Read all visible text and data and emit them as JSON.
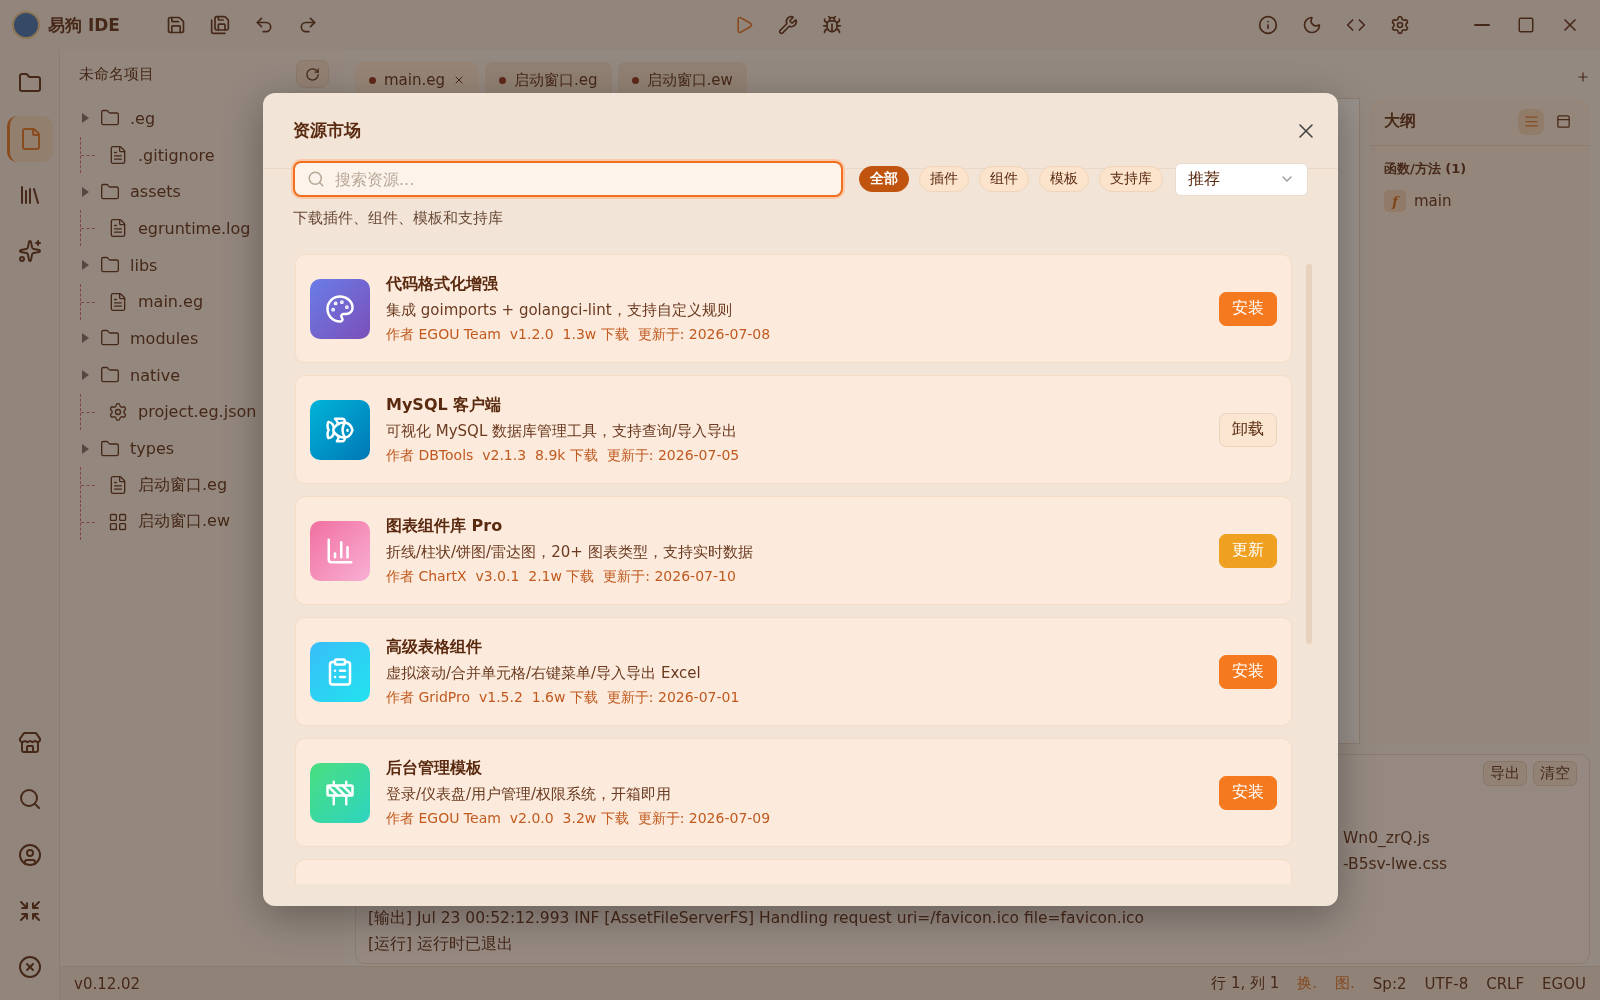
{
  "app": {
    "title": "易狗 IDE",
    "version": "v0.12.02"
  },
  "activity_bar": {
    "top": [
      {
        "kind": "folder",
        "selected": false
      },
      {
        "kind": "file",
        "selected": true
      },
      {
        "kind": "library",
        "selected": false
      },
      {
        "kind": "sparkles",
        "selected": false
      }
    ],
    "bottom": [
      {
        "kind": "store"
      },
      {
        "kind": "search"
      },
      {
        "kind": "user"
      },
      {
        "kind": "collapse"
      },
      {
        "kind": "exit"
      }
    ]
  },
  "explorer": {
    "title": "未命名项目",
    "tree": [
      {
        "name": ".eg",
        "kind": "folder",
        "expanded": false
      },
      {
        "name": ".gitignore",
        "kind": "file"
      },
      {
        "name": "assets",
        "kind": "folder",
        "expanded": false
      },
      {
        "name": "egruntime.log",
        "kind": "file"
      },
      {
        "name": "libs",
        "kind": "folder",
        "expanded": false
      },
      {
        "name": "main.eg",
        "kind": "file"
      },
      {
        "name": "modules",
        "kind": "folder",
        "expanded": false
      },
      {
        "name": "native",
        "kind": "folder",
        "expanded": false
      },
      {
        "name": "project.eg.json",
        "kind": "config"
      },
      {
        "name": "types",
        "kind": "folder",
        "expanded": false
      },
      {
        "name": "启动窗口.eg",
        "kind": "file"
      },
      {
        "name": "启动窗口.ew",
        "kind": "form"
      }
    ]
  },
  "tabs": [
    {
      "label": "main.eg",
      "selected": true
    },
    {
      "label": "启动窗口.eg",
      "selected": false
    },
    {
      "label": "启动窗口.ew",
      "selected": false
    }
  ],
  "outline": {
    "title": "大纲",
    "views": [
      {
        "kind": "list",
        "selected": true
      },
      {
        "kind": "panel",
        "selected": false
      }
    ],
    "section": "函数/方法 (1)",
    "items": [
      {
        "badge": "f",
        "name": "main"
      }
    ]
  },
  "output": {
    "buttons": [
      "导出",
      "清空"
    ],
    "lines": [
      {
        "text": "Wn0_zrQ.js",
        "kind": "tail"
      },
      {
        "text": "-B5sv-lwe.css",
        "kind": "tail"
      },
      {
        "text": "[输出] Jul 23 00:52:12.993 INF [AssetFileServerFS] Handling request uri=/favicon.ico file=favicon.ico",
        "kind": "full"
      },
      {
        "text": "[运行] 运行时已退出",
        "kind": "full"
      }
    ]
  },
  "status_bar": {
    "items": [
      {
        "text": "行 1, 列 1",
        "kind": "plain"
      },
      {
        "text": "换.",
        "kind": "accent"
      },
      {
        "text": "图.",
        "kind": "accent"
      },
      {
        "text": "Sp:2",
        "kind": "plain"
      },
      {
        "text": "UTF-8",
        "kind": "plain"
      },
      {
        "text": "CRLF",
        "kind": "plain"
      },
      {
        "text": "EGOU",
        "kind": "plain"
      }
    ]
  },
  "dialog": {
    "title": "资源市场",
    "search": {
      "placeholder": "搜索资源..."
    },
    "filters": [
      {
        "label": "全部",
        "selected": true
      },
      {
        "label": "插件",
        "selected": false
      },
      {
        "label": "组件",
        "selected": false
      },
      {
        "label": "模板",
        "selected": false
      },
      {
        "label": "支持库",
        "selected": false
      }
    ],
    "sort": {
      "value": "推荐"
    },
    "subtitle": "下载插件、组件、模板和支持库",
    "resources": [
      {
        "name": "代码格式化增强",
        "description": "集成 goimports + golangci-lint，支持自定义规则",
        "meta": "作者 EGOU Team  v1.2.0  1.3w 下载  更新于: 2026-07-08",
        "action": {
          "label": "安装",
          "kind": "install"
        }
      },
      {
        "name": "MySQL 客户端",
        "description": "可视化 MySQL 数据库管理工具，支持查询/导入导出",
        "meta": "作者 DBTools  v2.1.3  8.9k 下载  更新于: 2026-07-05",
        "action": {
          "label": "卸载",
          "kind": "uninstall"
        }
      },
      {
        "name": "图表组件库 Pro",
        "description": "折线/柱状/饼图/雷达图，20+ 图表类型，支持实时数据",
        "meta": "作者 ChartX  v3.0.1  2.1w 下载  更新于: 2026-07-10",
        "action": {
          "label": "更新",
          "kind": "update"
        }
      },
      {
        "name": "高级表格组件",
        "description": "虚拟滚动/合并单元格/右键菜单/导入导出 Excel",
        "meta": "作者 GridPro  v1.5.2  1.6w 下载  更新于: 2026-07-01",
        "action": {
          "label": "安装",
          "kind": "install"
        }
      },
      {
        "name": "后台管理模板",
        "description": "登录/仪表盘/用户管理/权限系统，开箱即用",
        "meta": "作者 EGOU Team  v2.0.0  3.2w 下载  更新于: 2026-07-09",
        "action": {
          "label": "安装",
          "kind": "install"
        }
      }
    ]
  }
}
